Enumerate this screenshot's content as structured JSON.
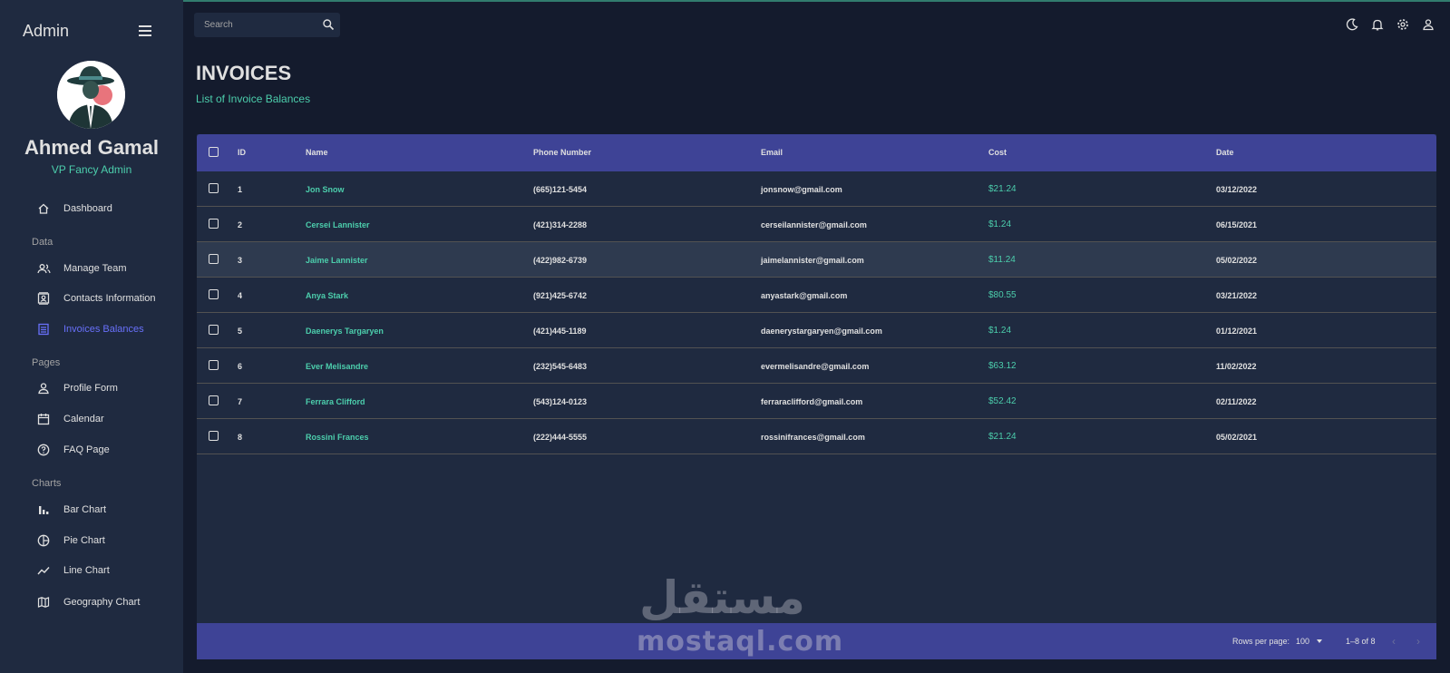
{
  "app": {
    "title": "Admin"
  },
  "user": {
    "name": "Ahmed Gamal",
    "role": "VP Fancy Admin"
  },
  "sidebar": {
    "items": [
      {
        "label": "Dashboard",
        "icon": "home-icon",
        "active": false
      },
      {
        "section": "Data"
      },
      {
        "label": "Manage Team",
        "icon": "team-icon",
        "active": false
      },
      {
        "label": "Contacts Information",
        "icon": "contacts-icon",
        "active": false
      },
      {
        "label": "Invoices Balances",
        "icon": "receipt-icon",
        "active": true
      },
      {
        "section": "Pages"
      },
      {
        "label": "Profile Form",
        "icon": "person-icon",
        "active": false
      },
      {
        "label": "Calendar",
        "icon": "calendar-icon",
        "active": false
      },
      {
        "label": "FAQ Page",
        "icon": "help-icon",
        "active": false
      },
      {
        "section": "Charts"
      },
      {
        "label": "Bar Chart",
        "icon": "bar-chart-icon",
        "active": false
      },
      {
        "label": "Pie Chart",
        "icon": "pie-chart-icon",
        "active": false
      },
      {
        "label": "Line Chart",
        "icon": "line-chart-icon",
        "active": false
      },
      {
        "label": "Geography Chart",
        "icon": "map-icon",
        "active": false
      }
    ]
  },
  "search": {
    "placeholder": "Search",
    "value": ""
  },
  "topbar": {
    "icons": [
      "dark-mode-icon",
      "notifications-icon",
      "settings-icon",
      "profile-icon"
    ]
  },
  "page": {
    "title": "INVOICES",
    "subtitle": "List of Invoice Balances"
  },
  "table": {
    "columns": [
      "ID",
      "Name",
      "Phone Number",
      "Email",
      "Cost",
      "Date"
    ],
    "rows": [
      {
        "id": "1",
        "name": "Jon Snow",
        "phone": "(665)121-5454",
        "email": "jonsnow@gmail.com",
        "cost": "$21.24",
        "date": "03/12/2022"
      },
      {
        "id": "2",
        "name": "Cersei Lannister",
        "phone": "(421)314-2288",
        "email": "cerseilannister@gmail.com",
        "cost": "$1.24",
        "date": "06/15/2021"
      },
      {
        "id": "3",
        "name": "Jaime Lannister",
        "phone": "(422)982-6739",
        "email": "jaimelannister@gmail.com",
        "cost": "$11.24",
        "date": "05/02/2022"
      },
      {
        "id": "4",
        "name": "Anya Stark",
        "phone": "(921)425-6742",
        "email": "anyastark@gmail.com",
        "cost": "$80.55",
        "date": "03/21/2022"
      },
      {
        "id": "5",
        "name": "Daenerys Targaryen",
        "phone": "(421)445-1189",
        "email": "daenerystargaryen@gmail.com",
        "cost": "$1.24",
        "date": "01/12/2021"
      },
      {
        "id": "6",
        "name": "Ever Melisandre",
        "phone": "(232)545-6483",
        "email": "evermelisandre@gmail.com",
        "cost": "$63.12",
        "date": "11/02/2022"
      },
      {
        "id": "7",
        "name": "Ferrara Clifford",
        "phone": "(543)124-0123",
        "email": "ferraraclifford@gmail.com",
        "cost": "$52.42",
        "date": "02/11/2022"
      },
      {
        "id": "8",
        "name": "Rossini Frances",
        "phone": "(222)444-5555",
        "email": "rossinifrances@gmail.com",
        "cost": "$21.24",
        "date": "05/02/2021"
      }
    ],
    "footer": {
      "rows_per_page_label": "Rows per page:",
      "rows_per_page": "100",
      "range": "1–8 of 8"
    }
  },
  "watermark": {
    "arabic": "مستقل",
    "latin": "mostaql.com"
  },
  "colors": {
    "accent": "#4cceac",
    "header": "#3e4396",
    "active": "#6870fa",
    "panel": "#1f2a40",
    "background": "#141b2d"
  }
}
